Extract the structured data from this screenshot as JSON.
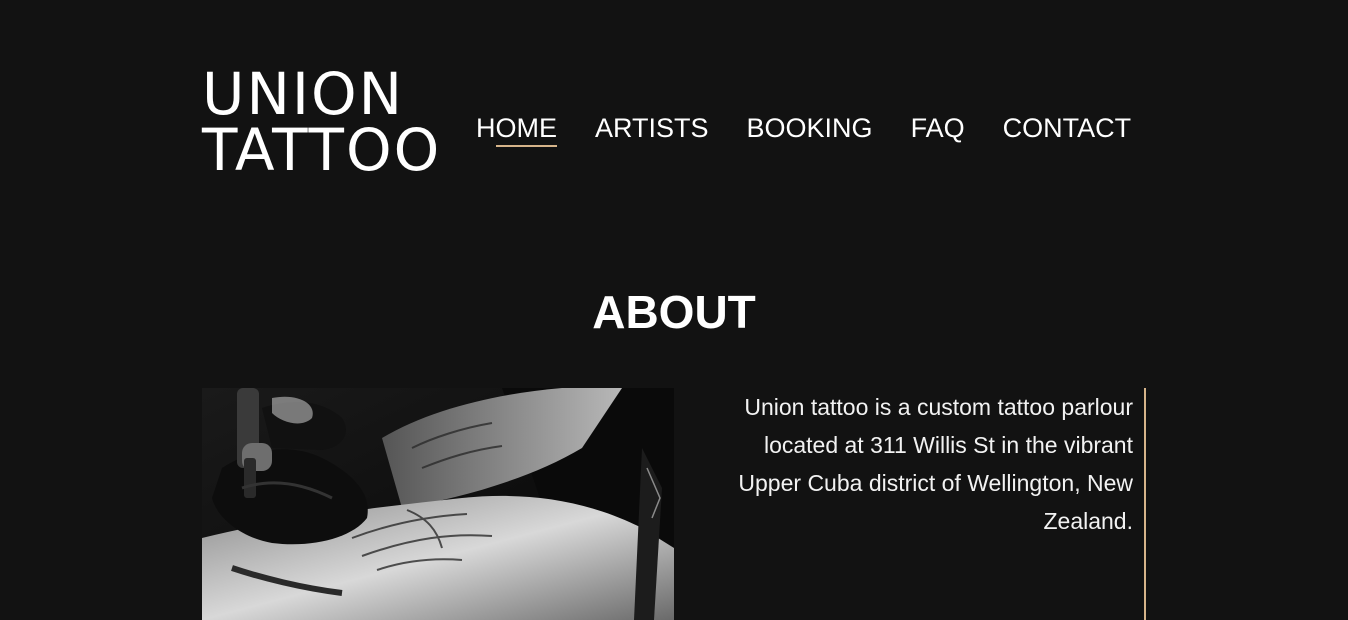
{
  "header": {
    "logo": {
      "line1": "UNION",
      "line2": "TATTOO"
    },
    "nav": {
      "items": [
        {
          "label": "HOME",
          "active": true
        },
        {
          "label": "ARTISTS",
          "active": false
        },
        {
          "label": "BOOKING",
          "active": false
        },
        {
          "label": "FAQ",
          "active": false
        },
        {
          "label": "CONTACT",
          "active": false
        }
      ]
    }
  },
  "about": {
    "title": "ABOUT",
    "body": "Union tattoo is a custom tattoo parlour located at 311 Willis St in the vibrant Upper Cuba district of Wellington, New Zealand."
  },
  "colors": {
    "background": "#121212",
    "text": "#ffffff",
    "accent": "#d6b48a"
  }
}
